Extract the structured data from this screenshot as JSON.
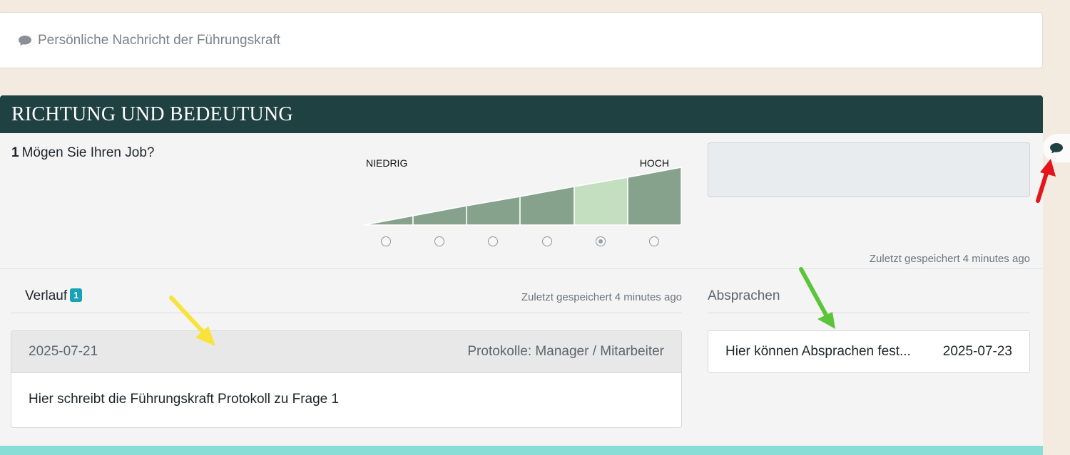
{
  "message": {
    "icon": "speech-bubble-icon",
    "text": "Persönliche Nachricht der Führungskraft"
  },
  "section": {
    "title": "RICHTUNG UND BEDEUTUNG",
    "question": {
      "number": "1",
      "text": "Mögen Sie Ihren Job?"
    },
    "scale": {
      "low_label": "NIEDRIG",
      "high_label": "HOCH",
      "steps": 6,
      "selected_index": 4,
      "colors": {
        "step": "#86a28d",
        "selected": "#c3dfbf"
      }
    },
    "answer_saved": "Zuletzt gespeichert 4 minutes ago",
    "comment_icon": "comment-icon"
  },
  "verlauf": {
    "title": "Verlauf",
    "badge": "1",
    "saved": "Zuletzt gespeichert 4 minutes ago",
    "entry": {
      "date": "2025-07-21",
      "protocol": "Protokolle: Manager / Mitarbeiter",
      "text": "Hier schreibt die Führungskraft Protokoll zu Frage 1"
    }
  },
  "absprachen": {
    "title": "Absprachen",
    "item": {
      "text": "Hier können Absprachen fest...",
      "date": "2025-07-23"
    }
  },
  "colors": {
    "header_bg": "#1f4141",
    "page_bg": "#f3ebe0",
    "accent_bar": "#88ded6",
    "badge": "#17a2b8"
  }
}
